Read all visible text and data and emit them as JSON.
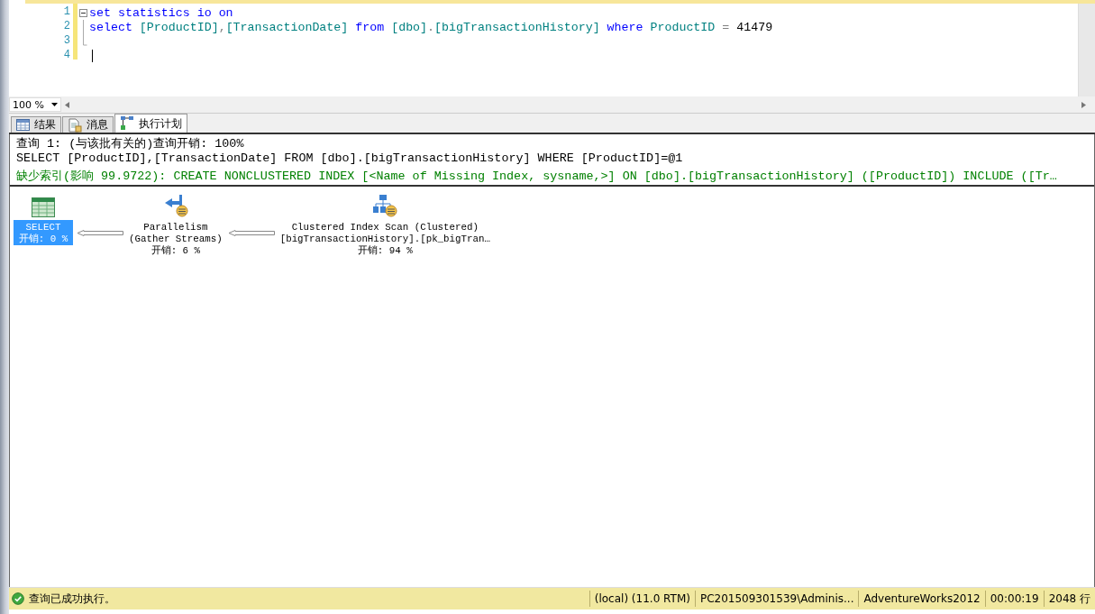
{
  "editor": {
    "lines": [
      {
        "number": "1",
        "kind": "fold_start",
        "caret": false,
        "tokens": [
          {
            "kind": "keyword",
            "text": "set statistics io on"
          }
        ]
      },
      {
        "number": "2",
        "kind": "fold_body",
        "caret": false,
        "tokens": [
          {
            "kind": "keyword",
            "text": "select"
          },
          {
            "kind": "ident",
            "text": " [ProductID]"
          },
          {
            "kind": "op",
            "text": ","
          },
          {
            "kind": "ident",
            "text": "[TransactionDate]"
          },
          {
            "kind": "keyword",
            "text": " from"
          },
          {
            "kind": "ident",
            "text": " [dbo]"
          },
          {
            "kind": "op",
            "text": "."
          },
          {
            "kind": "ident",
            "text": "[bigTransactionHistory]"
          },
          {
            "kind": "keyword",
            "text": " where"
          },
          {
            "kind": "ident",
            "text": " ProductID"
          },
          {
            "kind": "op",
            "text": " ="
          },
          {
            "kind": "number",
            "text": " 41479"
          }
        ]
      },
      {
        "number": "3",
        "kind": "fold_end",
        "caret": false
      },
      {
        "number": "4",
        "kind": "plain",
        "caret": true
      }
    ],
    "zoom": "100 %"
  },
  "tabs": [
    {
      "label": "结果",
      "selected": false
    },
    {
      "label": "消息",
      "selected": false
    },
    {
      "label": "执行计划",
      "selected": true
    }
  ],
  "messages": [
    {
      "kind": "header",
      "text": "查询 1: (与该批有关的)查询开销: 100%"
    },
    {
      "kind": "query",
      "text": "SELECT [ProductID],[TransactionDate] FROM [dbo].[bigTransactionHistory] WHERE [ProductID]=@1"
    },
    {
      "kind": "missing_index",
      "text": "缺少索引(影响 99.9722): CREATE NONCLUSTERED INDEX [<Name of Missing Index, sysname,>] ON [dbo].[bigTransactionHistory] ([ProductID]) INCLUDE ([Tr…"
    }
  ],
  "plan_nodes": [
    {
      "kind": "select",
      "lines": [
        "SELECT"
      ],
      "cost": "开销: 0 %",
      "selected": true
    },
    {
      "kind": "parallelism",
      "lines": [
        "Parallelism",
        "(Gather Streams)"
      ],
      "cost": "开销: 6 %",
      "selected": false
    },
    {
      "kind": "scan",
      "lines": [
        "Clustered Index Scan (Clustered)",
        "[bigTransactionHistory].[pk_bigTran…"
      ],
      "cost": "开销: 94 %",
      "selected": false
    }
  ],
  "status_bar": {
    "message": "查询已成功执行。",
    "segments": [
      "(local) (11.0 RTM)",
      "PC201509301539\\Adminis...",
      "AdventureWorks2012",
      "00:00:19",
      "2048 行"
    ]
  }
}
